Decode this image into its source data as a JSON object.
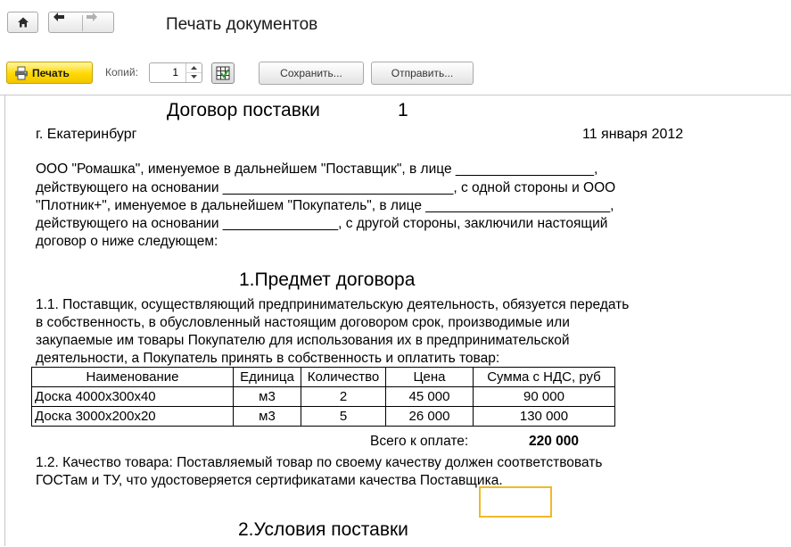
{
  "window": {
    "title": "Печать документов",
    "nav": {
      "home_icon": "home-icon",
      "back_icon": "arrow-left-icon",
      "forward_icon": "arrow-right-icon"
    }
  },
  "toolbar": {
    "print_label": "Печать",
    "copies_label": "Копий:",
    "copies_value": "1",
    "save_label": "Сохранить...",
    "send_label": "Отправить..."
  },
  "document": {
    "title": "Договор поставки",
    "number": "1",
    "city": "г. Екатеринбург",
    "date": "11 января 2012",
    "preamble": [
      "ООО \"Ромашка\", именуемое в дальнейшем \"Поставщик\", в лице __________________,",
      "действующего на основании ______________________________, с одной стороны и ООО",
      "\"Плотник+\", именуемое в дальнейшем \"Покупатель\", в лице ________________________,",
      "действующего на основании _______________, с другой стороны, заключили настоящий",
      "договор о ниже следующем:"
    ],
    "section1_title": "1.Предмет договора",
    "section1_text": [
      "1.1. Поставщик, осуществляющий предпринимательскую деятельность, обязуется передать",
      "в собственность, в обусловленный настоящим договором срок, производимые или",
      "закупаемые им товары Покупателю для использования их в предпринимательской",
      "деятельности, а Покупатель принять в собственность и оплатить товар:"
    ],
    "table": {
      "headers": [
        "Наименование",
        "Единица",
        "Количество",
        "Цена",
        "Сумма с НДС, руб"
      ],
      "rows": [
        [
          "Доска 4000х300х40",
          "м3",
          "2",
          "45 000",
          "90 000"
        ],
        [
          "Доска 3000х200х20",
          "м3",
          "5",
          "26 000",
          "130 000"
        ]
      ],
      "total_label": "Всего к оплате:",
      "total_value": "220 000"
    },
    "section1_2_text": [
      "1.2. Качество товара: Поставляемый товар по своему качеству должен соответствовать",
      "ГОСТам и ТУ, что удостоверяется сертификатами качества Поставщика."
    ],
    "section2_title": "2.Условия поставки"
  }
}
